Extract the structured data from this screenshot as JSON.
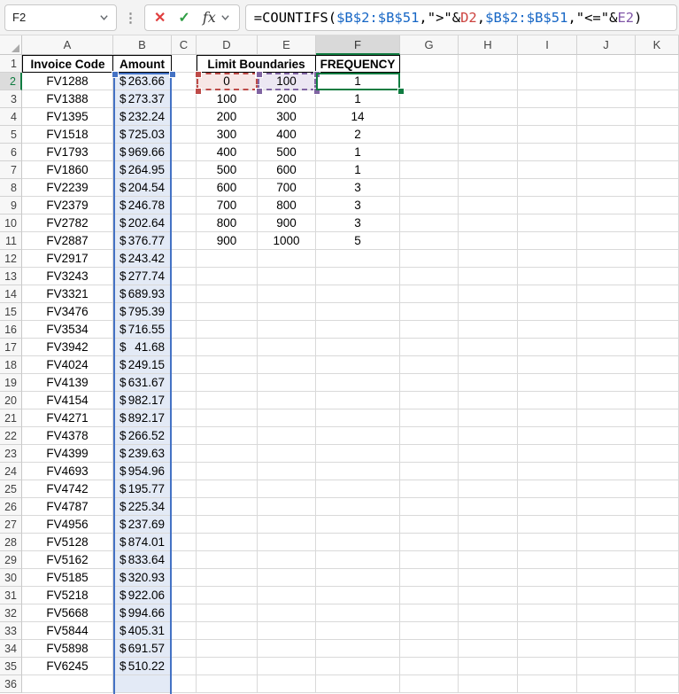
{
  "formula_bar": {
    "name_box": "F2",
    "cancel_label": "✕",
    "confirm_label": "✓",
    "fx_label": "fx",
    "formula_segments": [
      {
        "text": "=COUNTIFS(",
        "color": "#000000"
      },
      {
        "text": "$B$2:$B$51",
        "color": "#1666C5"
      },
      {
        "text": ",\">\"&",
        "color": "#000000"
      },
      {
        "text": "D2",
        "color": "#CC423E"
      },
      {
        "text": ",",
        "color": "#000000"
      },
      {
        "text": "$B$2:$B$51",
        "color": "#1666C5"
      },
      {
        "text": ",\"<=\"&",
        "color": "#000000"
      },
      {
        "text": "E2",
        "color": "#8157A8"
      },
      {
        "text": ")",
        "color": "#000000"
      }
    ]
  },
  "sheet": {
    "column_letters": [
      "A",
      "B",
      "C",
      "D",
      "E",
      "F",
      "G",
      "H",
      "I",
      "J",
      "K"
    ],
    "selected_column": "F",
    "selected_row": 2,
    "first_row": 1,
    "row_count": 36,
    "headers": {
      "invoice_code": "Invoice Code",
      "amount": "Amount",
      "limit_boundaries": "Limit Boundaries",
      "frequency": "FREQUENCY"
    },
    "currency_symbol": "$",
    "invoices": [
      {
        "code": "FV1288",
        "amount": "263.66"
      },
      {
        "code": "FV1388",
        "amount": "273.37"
      },
      {
        "code": "FV1395",
        "amount": "232.24"
      },
      {
        "code": "FV1518",
        "amount": "725.03"
      },
      {
        "code": "FV1793",
        "amount": "969.66"
      },
      {
        "code": "FV1860",
        "amount": "264.95"
      },
      {
        "code": "FV2239",
        "amount": "204.54"
      },
      {
        "code": "FV2379",
        "amount": "246.78"
      },
      {
        "code": "FV2782",
        "amount": "202.64"
      },
      {
        "code": "FV2887",
        "amount": "376.77"
      },
      {
        "code": "FV2917",
        "amount": "243.42"
      },
      {
        "code": "FV3243",
        "amount": "277.74"
      },
      {
        "code": "FV3321",
        "amount": "689.93"
      },
      {
        "code": "FV3476",
        "amount": "795.39"
      },
      {
        "code": "FV3534",
        "amount": "716.55"
      },
      {
        "code": "FV3942",
        "amount": "41.68"
      },
      {
        "code": "FV4024",
        "amount": "249.15"
      },
      {
        "code": "FV4139",
        "amount": "631.67"
      },
      {
        "code": "FV4154",
        "amount": "982.17"
      },
      {
        "code": "FV4271",
        "amount": "892.17"
      },
      {
        "code": "FV4378",
        "amount": "266.52"
      },
      {
        "code": "FV4399",
        "amount": "239.63"
      },
      {
        "code": "FV4693",
        "amount": "954.96"
      },
      {
        "code": "FV4742",
        "amount": "195.77"
      },
      {
        "code": "FV4787",
        "amount": "225.34"
      },
      {
        "code": "FV4956",
        "amount": "237.69"
      },
      {
        "code": "FV5128",
        "amount": "874.01"
      },
      {
        "code": "FV5162",
        "amount": "833.64"
      },
      {
        "code": "FV5185",
        "amount": "320.93"
      },
      {
        "code": "FV5218",
        "amount": "922.06"
      },
      {
        "code": "FV5668",
        "amount": "994.66"
      },
      {
        "code": "FV5844",
        "amount": "405.31"
      },
      {
        "code": "FV5898",
        "amount": "691.57"
      },
      {
        "code": "FV6245",
        "amount": "510.22"
      }
    ],
    "bins": [
      {
        "lower": "0",
        "upper": "100",
        "frequency": "1"
      },
      {
        "lower": "100",
        "upper": "200",
        "frequency": "1"
      },
      {
        "lower": "200",
        "upper": "300",
        "frequency": "14"
      },
      {
        "lower": "300",
        "upper": "400",
        "frequency": "2"
      },
      {
        "lower": "400",
        "upper": "500",
        "frequency": "1"
      },
      {
        "lower": "500",
        "upper": "600",
        "frequency": "1"
      },
      {
        "lower": "600",
        "upper": "700",
        "frequency": "3"
      },
      {
        "lower": "700",
        "upper": "800",
        "frequency": "3"
      },
      {
        "lower": "800",
        "upper": "900",
        "frequency": "3"
      },
      {
        "lower": "900",
        "upper": "1000",
        "frequency": "5"
      }
    ]
  },
  "colors": {
    "range_blue": "#4472C4",
    "range_blue_fill": "#E3EAF6",
    "range_red": "#BE4B48",
    "range_red_fill": "#F7E7E6",
    "range_purple": "#8064A2",
    "range_purple_fill": "#ECE7F3",
    "active_green": "#107C41"
  }
}
